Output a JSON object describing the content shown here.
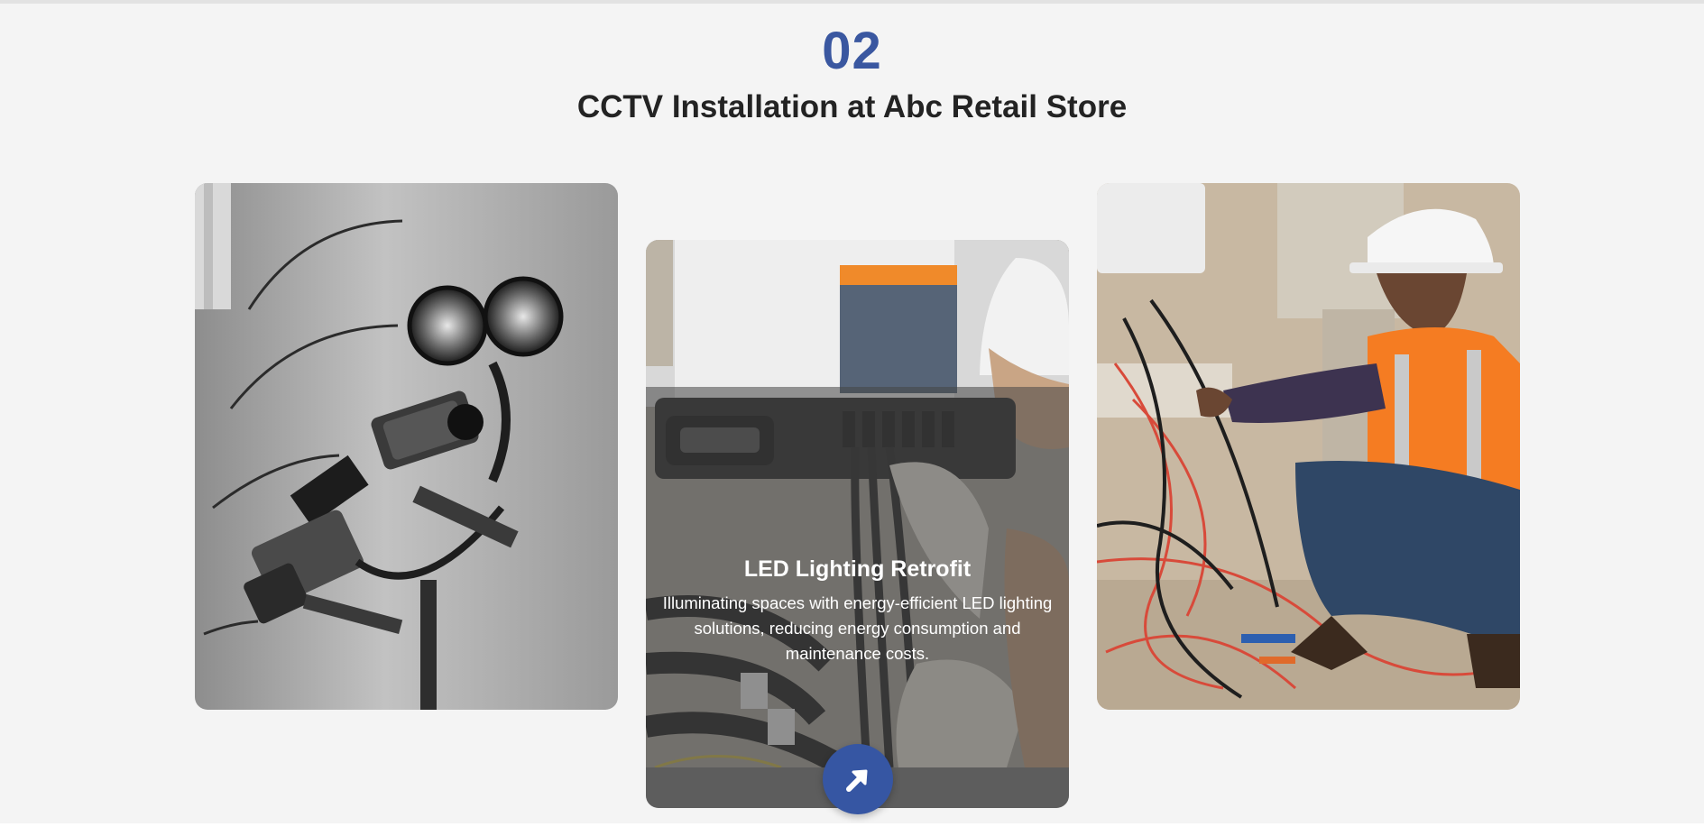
{
  "section": {
    "number": "02",
    "title": "CCTV Installation at Abc Retail Store"
  },
  "cards": {
    "left": {
      "image": "cctv-cameras-photo"
    },
    "center": {
      "image": "electrician-wiring-photo",
      "title": "LED Lighting Retrofit",
      "description": "Illuminating spaces with energy-efficient LED lighting solutions, reducing energy consumption and maintenance costs."
    },
    "right": {
      "image": "technician-hard-hat-photo"
    }
  },
  "action": {
    "icon": "arrow-up-right-icon"
  },
  "colors": {
    "accent": "#3a57a0",
    "button": "#3656a3",
    "title": "#232323",
    "background": "#f4f4f4"
  }
}
